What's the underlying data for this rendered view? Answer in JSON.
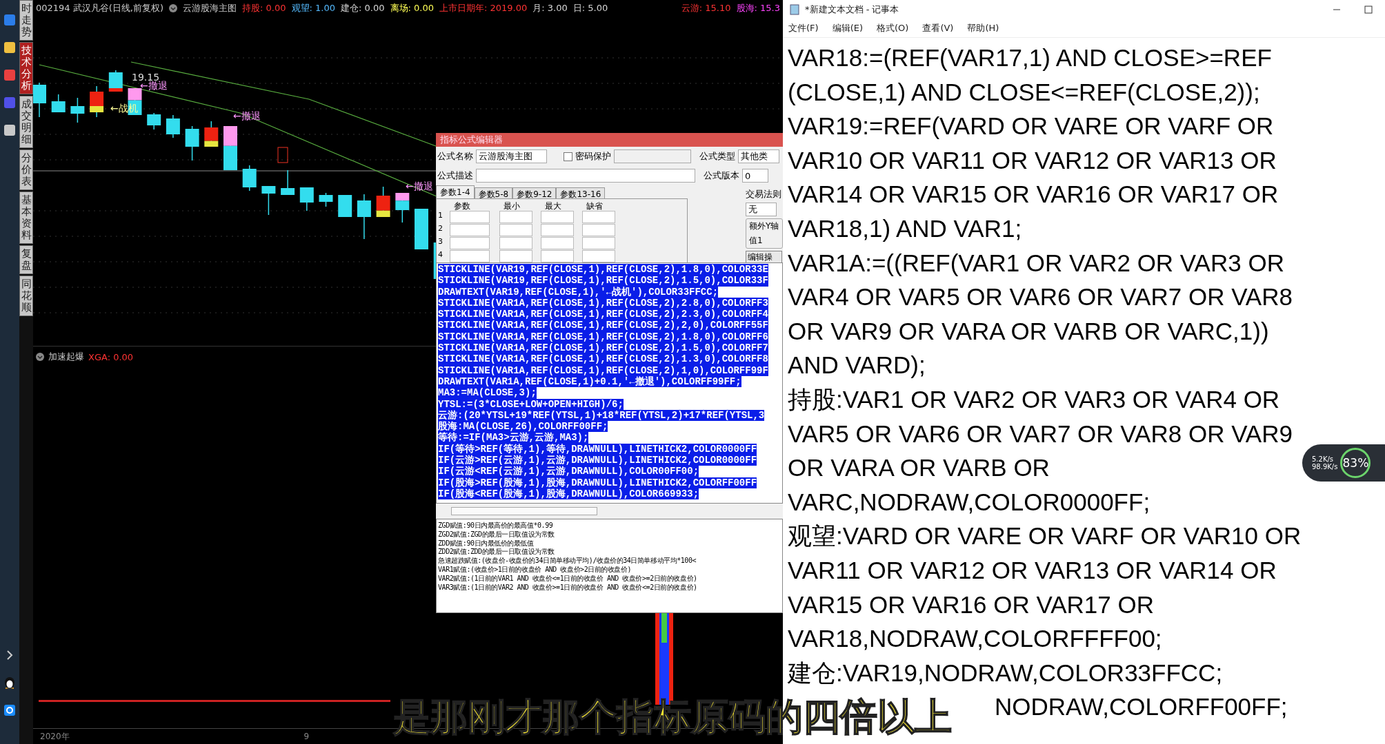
{
  "side_tabs": [
    {
      "label": "时走势",
      "selected": false
    },
    {
      "label": "技术分析",
      "selected": true
    },
    {
      "label": "成交明细",
      "selected": false
    },
    {
      "label": "分价表",
      "selected": false
    },
    {
      "label": "基本资料",
      "selected": false
    },
    {
      "label": "复盘",
      "selected": false
    },
    {
      "label": "同花顺",
      "selected": false
    }
  ],
  "chart": {
    "code": "002194",
    "name": "武汉凡谷(日线,前复权)",
    "indicator": "云游股海主图",
    "values": [
      {
        "label": "持股:",
        "value": "0.00",
        "color": "#ff3333"
      },
      {
        "label": "观望:",
        "value": "1.00",
        "color": "#55bbff"
      },
      {
        "label": "建仓:",
        "value": "0.00",
        "color": "#d8d8d8"
      },
      {
        "label": "离场:",
        "value": "0.00",
        "color": "#ffff55"
      },
      {
        "label": "上市日期年:",
        "value": "2019.00",
        "color": "#ff3333"
      },
      {
        "label": "月:",
        "value": "3.00",
        "color": "#d8d8d8"
      },
      {
        "label": "日:",
        "value": "5.00",
        "color": "#d8d8d8"
      }
    ],
    "right_values": [
      {
        "label": "云游:",
        "value": "15.10",
        "color": "#ff3333"
      },
      {
        "label": "股海:",
        "value": "15.3",
        "color": "#ff44ff"
      }
    ],
    "labels": [
      "19.15",
      "←撤退",
      "←战机",
      "←撤退",
      "←撤退"
    ],
    "lower_panel": {
      "title": "加速起爆",
      "value_label": "XGA:",
      "value": "0.00"
    },
    "axis_labels": [
      "2020年",
      "9"
    ]
  },
  "formula_editor": {
    "title": "指标公式编辑器",
    "name_label": "公式名称",
    "name_value": "云游股海主图",
    "password": {
      "label": "密码保护",
      "checked": false
    },
    "type_label": "公式类型",
    "type_value": "其他类",
    "desc_label": "公式描述",
    "version_label": "公式版本",
    "version_value": "0",
    "tabs": [
      {
        "label": "参数1-4",
        "selected": true
      },
      {
        "label": "参数5-8",
        "selected": false
      },
      {
        "label": "参数9-12",
        "selected": false
      },
      {
        "label": "参数13-16",
        "selected": false
      }
    ],
    "param_columns": [
      "参数",
      "最小",
      "最大",
      "缺省"
    ],
    "param_rows": [
      "1",
      "2",
      "3",
      "4"
    ],
    "rule_label": "交易法则",
    "rule_value": "无",
    "axis_group": "额外Y轴",
    "value1_label": "值1",
    "edit_button": "编辑操",
    "code_selected": true,
    "code_lines": [
      "STICKLINE(VAR19,REF(CLOSE,1),REF(CLOSE,2),1.8,0),COLOR33E",
      "STICKLINE(VAR19,REF(CLOSE,1),REF(CLOSE,2),1.5,0),COLOR33F",
      "DRAWTEXT(VAR19,REF(CLOSE,1),'←战机'),COLOR33FFCC;",
      "STICKLINE(VAR1A,REF(CLOSE,1),REF(CLOSE,2),2.8,0),COLORFF3",
      "STICKLINE(VAR1A,REF(CLOSE,1),REF(CLOSE,2),2.3,0),COLORFF4",
      "STICKLINE(VAR1A,REF(CLOSE,1),REF(CLOSE,2),2,0),COLORFF55F",
      "STICKLINE(VAR1A,REF(CLOSE,1),REF(CLOSE,2),1.8,0),COLORFF6",
      "STICKLINE(VAR1A,REF(CLOSE,1),REF(CLOSE,2),1.5,0),COLORFF7",
      "STICKLINE(VAR1A,REF(CLOSE,1),REF(CLOSE,2),1.3,0),COLORFF8",
      "STICKLINE(VAR1A,REF(CLOSE,1),REF(CLOSE,2),1,0),COLORFF99F",
      "DRAWTEXT(VAR1A,REF(CLOSE,1)+0.1,'←撤退'),COLORFF99FF;",
      "MA3:=MA(CLOSE,3);",
      "YTSL:=(3*CLOSE+LOW+OPEN+HIGH)/6;",
      "云游:(20*YTSL+19*REF(YTSL,1)+18*REF(YTSL,2)+17*REF(YTSL,3",
      "股海:MA(CLOSE,26),COLORFF00FF;",
      "等待:=IF(MA3>云游,云游,MA3);",
      "IF(等待>REF(等待,1),等待,DRAWNULL),LINETHICK2,COLOR0000FF",
      "IF(云游>REF(云游,1),云游,DRAWNULL),LINETHICK2,COLOR0000FF",
      "IF(云游<REF(云游,1),云游,DRAWNULL),COLOR00FF00;",
      "IF(股海>REF(股海,1),股海,DRAWNULL),LINETHICK2,COLORFF00FF",
      "IF(股海<REF(股海,1),股海,DRAWNULL),COLOR669933;"
    ],
    "help_lines": [
      "ZGD赋值:90日内最高价的最高值*0.99",
      "ZGD2赋值:ZGD的最后一日取值设为常数",
      "ZDD赋值:90日内最低价的最低值",
      "ZDD2赋值:ZDD的最后一日取值设为常数",
      "急速超跌赋值:(收盘价-收盘价的34日简单移动平均)/收盘价的34日简单移动平均*100<",
      "VAR1赋值:(收盘价>1日前的收盘价 AND 收盘价>2日前的收盘价)",
      "VAR2赋值:(1日前的VAR1 AND 收盘价<=1日前的收盘价 AND 收盘价>=2日前的收盘价)",
      "VAR3赋值:(1日前的VAR2 AND 收盘价>=1日前的收盘价 AND 收盘价<=2日前的收盘价)"
    ]
  },
  "notepad": {
    "title": "*新建文本文档 - 记事本",
    "menu": [
      "文件(F)",
      "编辑(E)",
      "格式(O)",
      "查看(V)",
      "帮助(H)"
    ],
    "lines": [
      {
        "text": "VAR18:=(REF(VAR17,1) AND CLOSE>=REF",
        "kind": "full"
      },
      {
        "text": "(CLOSE,1) AND CLOSE<=REF(CLOSE,2));",
        "kind": "full"
      },
      {
        "text": "VAR19:=REF(VARD OR VARE OR VARF OR",
        "kind": "full"
      },
      {
        "text": "VAR10 OR VAR11 OR VAR12 OR VAR13 OR",
        "kind": "full"
      },
      {
        "text": "VAR14 OR VAR15 OR VAR16 OR VAR17 OR",
        "kind": "full"
      },
      {
        "text": "VAR18,1) AND VAR1;",
        "kind": "full"
      },
      {
        "text": "VAR1A:=((REF(VAR1 OR VAR2 OR VAR3 OR",
        "kind": "full"
      },
      {
        "text": "VAR4 OR VAR5 OR VAR6 OR VAR7 OR VAR8",
        "kind": "full"
      },
      {
        "text": "OR VAR9 OR VARA OR VARB OR VARC,1))",
        "kind": "full"
      },
      {
        "text": "AND VARD);",
        "kind": "full"
      },
      {
        "text": "持股:VAR1 OR VAR2 OR VAR3 OR VAR4 OR",
        "kind": "full"
      },
      {
        "text": "VAR5 OR VAR6 OR VAR7 OR VAR8 OR VAR9",
        "kind": "full"
      },
      {
        "text": "OR VARA OR VARB OR",
        "kind": "full"
      },
      {
        "text": "VARC,NODRAW,COLOR0000FF;",
        "kind": "full"
      },
      {
        "text": "观望:VARD OR VARE OR VARF OR VAR10 OR",
        "kind": "full"
      },
      {
        "text": "VAR11 OR VAR12 OR VAR13 OR VAR14 OR",
        "kind": "full"
      },
      {
        "text": "VAR15 OR VAR16 OR VAR17 OR",
        "kind": "full"
      },
      {
        "text": "VAR18,NODRAW,COLORFFFF00;",
        "kind": "full"
      },
      {
        "text": "建仓:VAR19,NODRAW,COLOR33FFCC;",
        "kind": "full"
      },
      {
        "text": "NODRAW,COLORFF00FF;",
        "kind": "covered"
      }
    ]
  },
  "network_widget": {
    "upload": "5.2K/s",
    "download": "98.9K/s",
    "percent": "83%"
  },
  "subtitle": "是那刚才那个指标原码的四倍以上"
}
